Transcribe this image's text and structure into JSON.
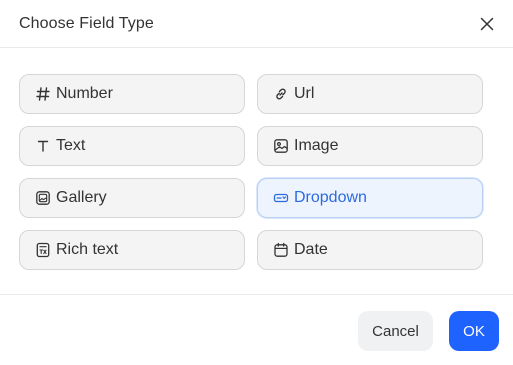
{
  "dialog": {
    "title": "Choose Field Type",
    "close_icon": "close-icon"
  },
  "options": [
    {
      "label": "Number",
      "icon": "hash-icon",
      "selected": false
    },
    {
      "label": "Url",
      "icon": "link-icon",
      "selected": false
    },
    {
      "label": "Text",
      "icon": "text-icon",
      "selected": false
    },
    {
      "label": "Image",
      "icon": "image-icon",
      "selected": false
    },
    {
      "label": "Gallery",
      "icon": "gallery-icon",
      "selected": false
    },
    {
      "label": "Dropdown",
      "icon": "dropdown-icon",
      "selected": true
    },
    {
      "label": "Rich text",
      "icon": "rich-text-icon",
      "selected": false
    },
    {
      "label": "Date",
      "icon": "calendar-icon",
      "selected": false
    }
  ],
  "footer": {
    "cancel_label": "Cancel",
    "ok_label": "OK"
  },
  "colors": {
    "accent": "#1f63ff",
    "selected_text": "#2c6ae0",
    "selected_bg": "#eef4fd"
  }
}
